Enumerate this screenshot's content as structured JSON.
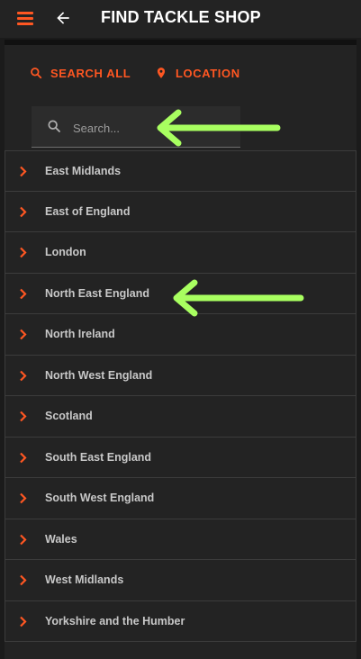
{
  "header": {
    "title": "FIND TACKLE SHOP",
    "menu_icon": "hamburger-menu-icon",
    "back_icon": "arrow-left-icon"
  },
  "tabs": [
    {
      "label": "SEARCH ALL",
      "icon": "search-icon"
    },
    {
      "label": "LOCATION",
      "icon": "location-pin-icon"
    }
  ],
  "search": {
    "placeholder": "Search...",
    "value": ""
  },
  "regions": [
    "East Midlands",
    "East of England",
    "London",
    "North East England",
    "North Ireland",
    "North West England",
    "Scotland",
    "South East England",
    "South West England",
    "Wales",
    "West Midlands",
    "Yorkshire and the Humber"
  ],
  "colors": {
    "accent": "#ff5722",
    "annotation_arrow": "#a8ff60",
    "background": "#232323"
  }
}
